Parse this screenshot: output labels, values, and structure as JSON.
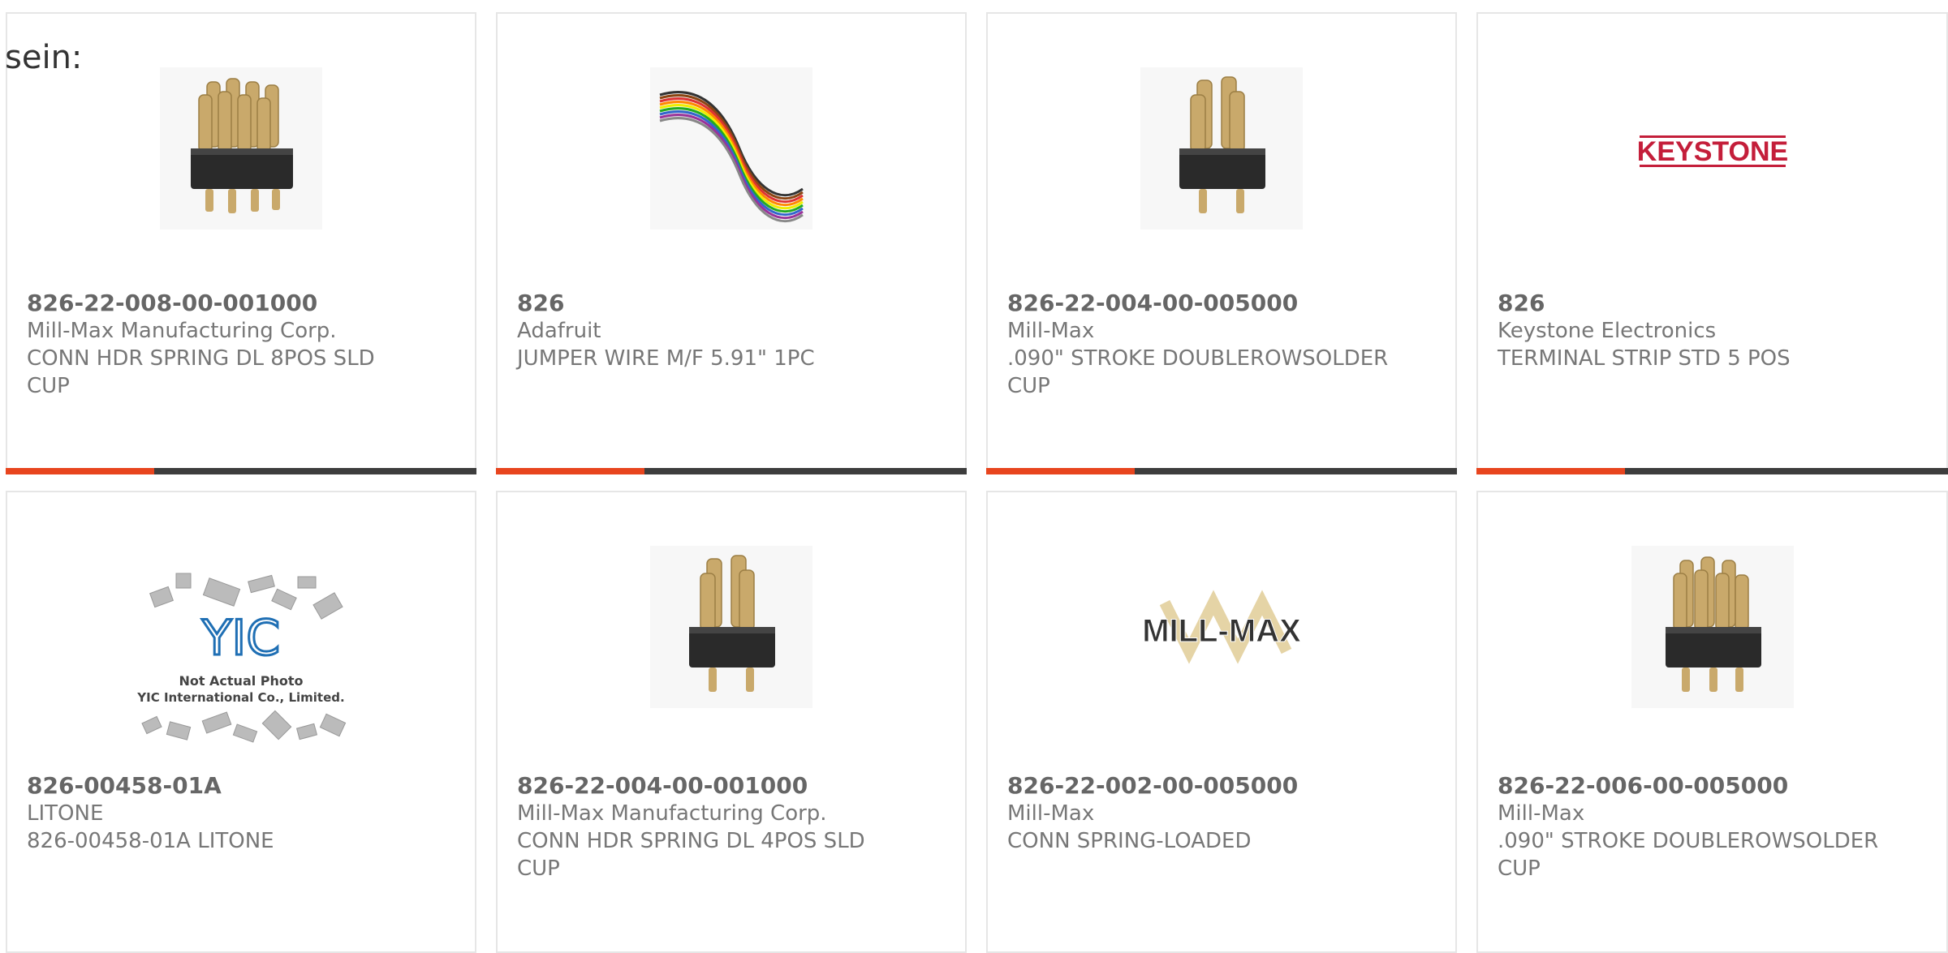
{
  "intro_text": "sein:",
  "accent_color": "#e8451e",
  "bar_color": "#3d3d3d",
  "products": [
    {
      "part_number": "826-22-008-00-001000",
      "manufacturer": "Mill-Max Manufacturing Corp.",
      "description": "CONN HDR SPRING DL 8POS SLD CUP",
      "image": "spring-connector-image"
    },
    {
      "part_number": "826",
      "manufacturer": "Adafruit",
      "description": "JUMPER WIRE M/F 5.91\" 1PC",
      "image": "jumper-wire-image"
    },
    {
      "part_number": "826-22-004-00-005000",
      "manufacturer": "Mill-Max",
      "description": ".090\" STROKE DOUBLEROWSOLDER CUP",
      "image": "spring-connector-image"
    },
    {
      "part_number": "826",
      "manufacturer": "Keystone Electronics",
      "description": "TERMINAL STRIP STD 5 POS",
      "image": "keystone-logo",
      "logo_text": "KEYSTONE"
    },
    {
      "part_number": "826-00458-01A",
      "manufacturer": "LITONE",
      "description": "826-00458-01A LITONE",
      "image": "not-actual-photo-image",
      "logo_text": "YIC",
      "caption_line1": "Not Actual Photo",
      "caption_line2": "YIC International Co., Limited."
    },
    {
      "part_number": "826-22-004-00-001000",
      "manufacturer": "Mill-Max Manufacturing Corp.",
      "description": "CONN HDR SPRING DL 4POS SLD CUP",
      "image": "spring-connector-image"
    },
    {
      "part_number": "826-22-002-00-005000",
      "manufacturer": "Mill-Max",
      "description": "CONN SPRING-LOADED",
      "image": "millmax-logo",
      "logo_text": "MILL-MAX"
    },
    {
      "part_number": "826-22-006-00-005000",
      "manufacturer": "Mill-Max",
      "description": ".090\" STROKE DOUBLEROWSOLDER CUP",
      "image": "spring-connector-image"
    }
  ]
}
